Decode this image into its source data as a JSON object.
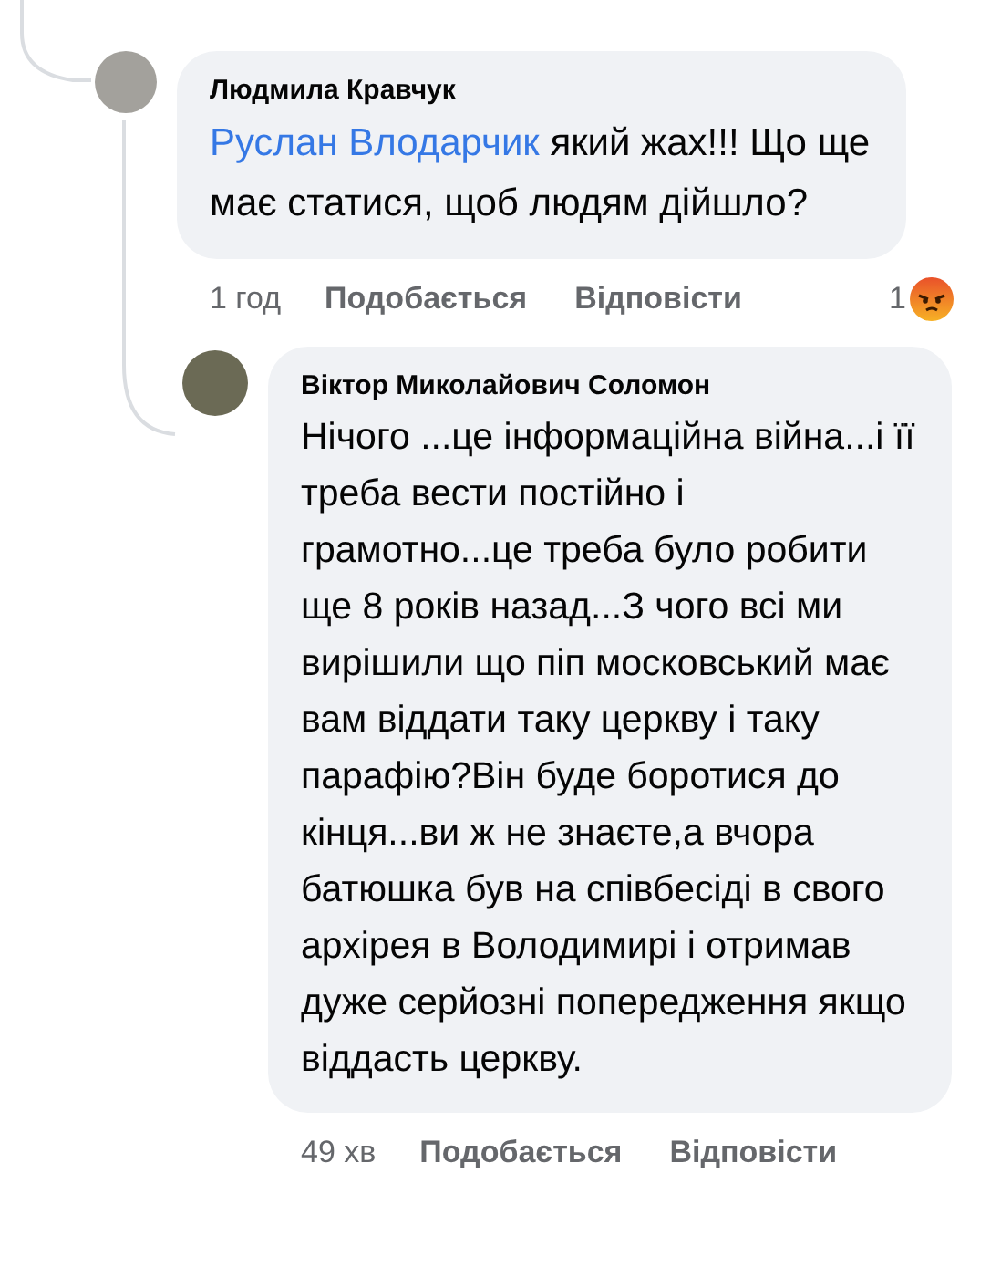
{
  "comments": [
    {
      "author": "Людмила Кравчук",
      "mention": "Руслан Влодарчик",
      "text": "який жах!!! Що ще має статися, щоб людям дійшло?",
      "time": "1 год",
      "like": "Подобається",
      "reply": "Відповісти",
      "reaction": {
        "kind": "angry",
        "count": "1"
      },
      "kind": "comment"
    },
    {
      "author": "Віктор Миколайович Соломон",
      "text": "Нічого ...це інформаційна війна...і її треба вести постійно і грамотно...це треба було робити ще 8 років назад...З чого всі ми вирішили що піп московський має вам віддати таку церкву і таку парафію?Він буде боротися до кінця...ви ж не знаєте,а вчора батюшка був на співбесіді в свого архірея в Володимирі і отримав дуже серйозні попередження якщо віддасть церкву.",
      "time": "49 хв",
      "like": "Подобається",
      "reply": "Відповісти",
      "kind": "reply"
    }
  ]
}
